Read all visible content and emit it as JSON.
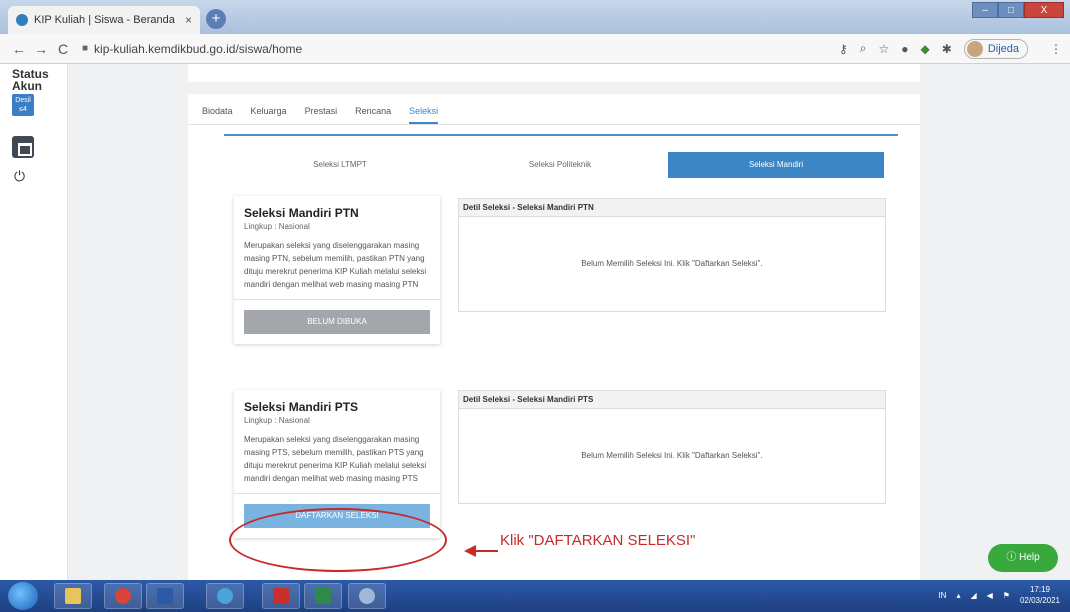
{
  "browser": {
    "tab_title": "KIP Kuliah | Siswa - Beranda",
    "tab_close": "×",
    "new_tab": "+",
    "url": "kip-kuliah.kemdikbud.go.id/siswa/home",
    "profile_name": "Dijeda",
    "win_min": "–",
    "win_max": "□",
    "win_close": "X"
  },
  "sidebar": {
    "status_label": "Status Akun",
    "desil_badge": "Desil ≤4"
  },
  "tabs": [
    "Biodata",
    "Keluarga",
    "Prestasi",
    "Rencana",
    "Seleksi"
  ],
  "active_tab": "Seleksi",
  "subtabs": [
    "Seleksi LTMPT",
    "Seleksi Politeknik",
    "Seleksi Mandiri"
  ],
  "active_subtab": "Seleksi Mandiri",
  "cards": [
    {
      "title": "Seleksi Mandiri PTN",
      "scope": "Lingkup : Nasional",
      "description": "Merupakan seleksi yang diselenggarakan masing masing PTN, sebelum memilih, pastikan PTN yang dituju merekrut penerima KIP Kuliah melalui seleksi mandiri dengan melihat web masing masing PTN",
      "button": "BELUM DIBUKA",
      "detail_header": "Detil Seleksi - Seleksi Mandiri PTN",
      "detail_body": "Belum Memilih Seleksi Ini. Klik \"Daftarkan Seleksi\"."
    },
    {
      "title": "Seleksi Mandiri PTS",
      "scope": "Lingkup : Nasional",
      "description": "Merupakan seleksi yang diselenggarakan masing masing PTS, sebelum memilih, pastikan PTS yang dituju merekrut penerima KIP Kuliah melalui seleksi mandiri dengan melihat web masing masing PTS",
      "button": "DAFTARKAN SELEKSI",
      "detail_header": "Detil Seleksi - Seleksi Mandiri PTS",
      "detail_body": "Belum Memilih Seleksi Ini. Klik \"Daftarkan Seleksi\"."
    }
  ],
  "annotation": "Klik \"DAFTARKAN SELEKSI\"",
  "help_label": "Help",
  "taskbar": {
    "lang": "IN",
    "time": "17:19",
    "date": "02/03/2021"
  },
  "colors": {
    "accent": "#3d86c6",
    "annotation": "#c62a2a",
    "help": "#39a93e"
  }
}
